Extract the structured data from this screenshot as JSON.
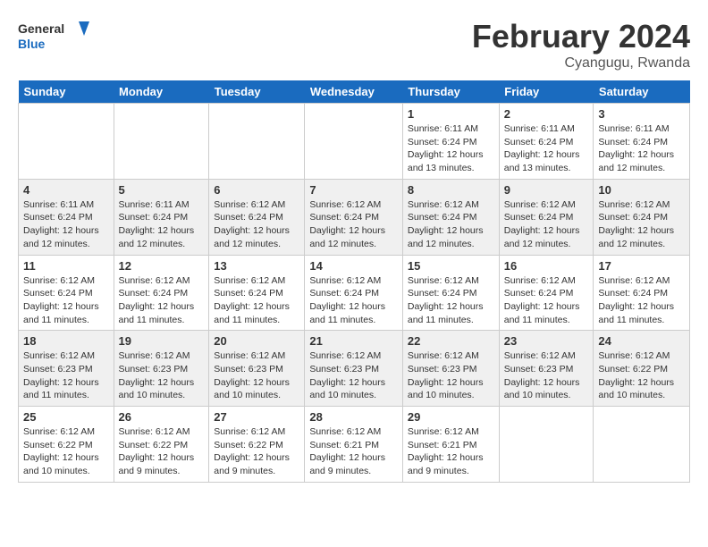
{
  "logo": {
    "line1": "General",
    "line2": "Blue"
  },
  "title": "February 2024",
  "subtitle": "Cyangugu, Rwanda",
  "days_of_week": [
    "Sunday",
    "Monday",
    "Tuesday",
    "Wednesday",
    "Thursday",
    "Friday",
    "Saturday"
  ],
  "weeks": [
    [
      {
        "day": "",
        "info": ""
      },
      {
        "day": "",
        "info": ""
      },
      {
        "day": "",
        "info": ""
      },
      {
        "day": "",
        "info": ""
      },
      {
        "day": "1",
        "info": "Sunrise: 6:11 AM\nSunset: 6:24 PM\nDaylight: 12 hours\nand 13 minutes."
      },
      {
        "day": "2",
        "info": "Sunrise: 6:11 AM\nSunset: 6:24 PM\nDaylight: 12 hours\nand 13 minutes."
      },
      {
        "day": "3",
        "info": "Sunrise: 6:11 AM\nSunset: 6:24 PM\nDaylight: 12 hours\nand 12 minutes."
      }
    ],
    [
      {
        "day": "4",
        "info": "Sunrise: 6:11 AM\nSunset: 6:24 PM\nDaylight: 12 hours\nand 12 minutes."
      },
      {
        "day": "5",
        "info": "Sunrise: 6:11 AM\nSunset: 6:24 PM\nDaylight: 12 hours\nand 12 minutes."
      },
      {
        "day": "6",
        "info": "Sunrise: 6:12 AM\nSunset: 6:24 PM\nDaylight: 12 hours\nand 12 minutes."
      },
      {
        "day": "7",
        "info": "Sunrise: 6:12 AM\nSunset: 6:24 PM\nDaylight: 12 hours\nand 12 minutes."
      },
      {
        "day": "8",
        "info": "Sunrise: 6:12 AM\nSunset: 6:24 PM\nDaylight: 12 hours\nand 12 minutes."
      },
      {
        "day": "9",
        "info": "Sunrise: 6:12 AM\nSunset: 6:24 PM\nDaylight: 12 hours\nand 12 minutes."
      },
      {
        "day": "10",
        "info": "Sunrise: 6:12 AM\nSunset: 6:24 PM\nDaylight: 12 hours\nand 12 minutes."
      }
    ],
    [
      {
        "day": "11",
        "info": "Sunrise: 6:12 AM\nSunset: 6:24 PM\nDaylight: 12 hours\nand 11 minutes."
      },
      {
        "day": "12",
        "info": "Sunrise: 6:12 AM\nSunset: 6:24 PM\nDaylight: 12 hours\nand 11 minutes."
      },
      {
        "day": "13",
        "info": "Sunrise: 6:12 AM\nSunset: 6:24 PM\nDaylight: 12 hours\nand 11 minutes."
      },
      {
        "day": "14",
        "info": "Sunrise: 6:12 AM\nSunset: 6:24 PM\nDaylight: 12 hours\nand 11 minutes."
      },
      {
        "day": "15",
        "info": "Sunrise: 6:12 AM\nSunset: 6:24 PM\nDaylight: 12 hours\nand 11 minutes."
      },
      {
        "day": "16",
        "info": "Sunrise: 6:12 AM\nSunset: 6:24 PM\nDaylight: 12 hours\nand 11 minutes."
      },
      {
        "day": "17",
        "info": "Sunrise: 6:12 AM\nSunset: 6:24 PM\nDaylight: 12 hours\nand 11 minutes."
      }
    ],
    [
      {
        "day": "18",
        "info": "Sunrise: 6:12 AM\nSunset: 6:23 PM\nDaylight: 12 hours\nand 11 minutes."
      },
      {
        "day": "19",
        "info": "Sunrise: 6:12 AM\nSunset: 6:23 PM\nDaylight: 12 hours\nand 10 minutes."
      },
      {
        "day": "20",
        "info": "Sunrise: 6:12 AM\nSunset: 6:23 PM\nDaylight: 12 hours\nand 10 minutes."
      },
      {
        "day": "21",
        "info": "Sunrise: 6:12 AM\nSunset: 6:23 PM\nDaylight: 12 hours\nand 10 minutes."
      },
      {
        "day": "22",
        "info": "Sunrise: 6:12 AM\nSunset: 6:23 PM\nDaylight: 12 hours\nand 10 minutes."
      },
      {
        "day": "23",
        "info": "Sunrise: 6:12 AM\nSunset: 6:23 PM\nDaylight: 12 hours\nand 10 minutes."
      },
      {
        "day": "24",
        "info": "Sunrise: 6:12 AM\nSunset: 6:22 PM\nDaylight: 12 hours\nand 10 minutes."
      }
    ],
    [
      {
        "day": "25",
        "info": "Sunrise: 6:12 AM\nSunset: 6:22 PM\nDaylight: 12 hours\nand 10 minutes."
      },
      {
        "day": "26",
        "info": "Sunrise: 6:12 AM\nSunset: 6:22 PM\nDaylight: 12 hours\nand 9 minutes."
      },
      {
        "day": "27",
        "info": "Sunrise: 6:12 AM\nSunset: 6:22 PM\nDaylight: 12 hours\nand 9 minutes."
      },
      {
        "day": "28",
        "info": "Sunrise: 6:12 AM\nSunset: 6:21 PM\nDaylight: 12 hours\nand 9 minutes."
      },
      {
        "day": "29",
        "info": "Sunrise: 6:12 AM\nSunset: 6:21 PM\nDaylight: 12 hours\nand 9 minutes."
      },
      {
        "day": "",
        "info": ""
      },
      {
        "day": "",
        "info": ""
      }
    ]
  ]
}
